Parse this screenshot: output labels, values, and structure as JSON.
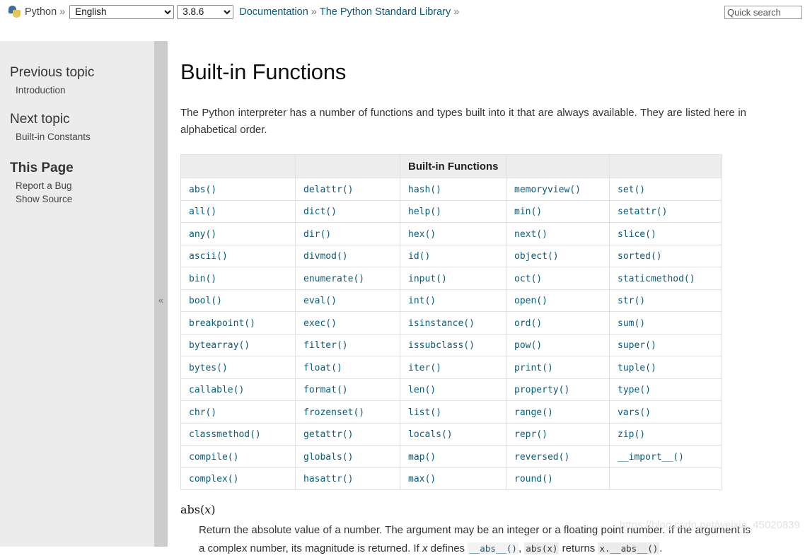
{
  "topbar": {
    "logo_icon": "python-logo-icon",
    "brand": "Python",
    "sep": "»",
    "language": {
      "selected": "English",
      "options": [
        "English"
      ]
    },
    "version": {
      "selected": "3.8.6",
      "options": [
        "3.8.6"
      ]
    },
    "documentation_link": "Documentation",
    "library_link": "The Python Standard Library",
    "search_placeholder": "Quick search",
    "search_value": ""
  },
  "sidebar": {
    "previous_topic_heading": "Previous topic",
    "previous_topic_link": "Introduction",
    "next_topic_heading": "Next topic",
    "next_topic_link": "Built-in Constants",
    "this_page_heading": "This Page",
    "this_page_links": [
      "Report a Bug",
      "Show Source"
    ],
    "collapse_icon": "«"
  },
  "main": {
    "title": "Built-in Functions",
    "intro": "The Python interpreter has a number of functions and types built into it that are always available. They are listed here in alphabetical order.",
    "table": {
      "header_label": "Built-in Functions",
      "header_cells": [
        "",
        "",
        "Built-in Functions",
        "",
        ""
      ],
      "rows": [
        [
          "abs()",
          "delattr()",
          "hash()",
          "memoryview()",
          "set()"
        ],
        [
          "all()",
          "dict()",
          "help()",
          "min()",
          "setattr()"
        ],
        [
          "any()",
          "dir()",
          "hex()",
          "next()",
          "slice()"
        ],
        [
          "ascii()",
          "divmod()",
          "id()",
          "object()",
          "sorted()"
        ],
        [
          "bin()",
          "enumerate()",
          "input()",
          "oct()",
          "staticmethod()"
        ],
        [
          "bool()",
          "eval()",
          "int()",
          "open()",
          "str()"
        ],
        [
          "breakpoint()",
          "exec()",
          "isinstance()",
          "ord()",
          "sum()"
        ],
        [
          "bytearray()",
          "filter()",
          "issubclass()",
          "pow()",
          "super()"
        ],
        [
          "bytes()",
          "float()",
          "iter()",
          "print()",
          "tuple()"
        ],
        [
          "callable()",
          "format()",
          "len()",
          "property()",
          "type()"
        ],
        [
          "chr()",
          "frozenset()",
          "list()",
          "range()",
          "vars()"
        ],
        [
          "classmethod()",
          "getattr()",
          "locals()",
          "repr()",
          "zip()"
        ],
        [
          "compile()",
          "globals()",
          "map()",
          "reversed()",
          "__import__()"
        ],
        [
          "complex()",
          "hasattr()",
          "max()",
          "round()",
          ""
        ]
      ]
    },
    "definition": {
      "signature_name": "abs",
      "signature_open": "(",
      "signature_param": "x",
      "signature_close": ")",
      "text_1": "Return the absolute value of a number. The argument may be an integer or a floating point number. If the argument is a complex number, its magnitude is returned. If ",
      "param_italic": "x",
      "text_2": " defines ",
      "code_link": "__abs__()",
      "text_3": ", ",
      "code_inline": "abs(x)",
      "text_4": " returns ",
      "code_inline_2": "x.__abs__()",
      "text_5": "."
    }
  },
  "watermark": "https://blog.csdn.net/weixin_45020839",
  "colors": {
    "link": "#0b5a7a",
    "sidebar_bg": "#ececec",
    "sidebar_edge": "#cccccc",
    "table_header_bg": "#ededed",
    "table_border": "#e1e1e1",
    "text": "#333333"
  }
}
